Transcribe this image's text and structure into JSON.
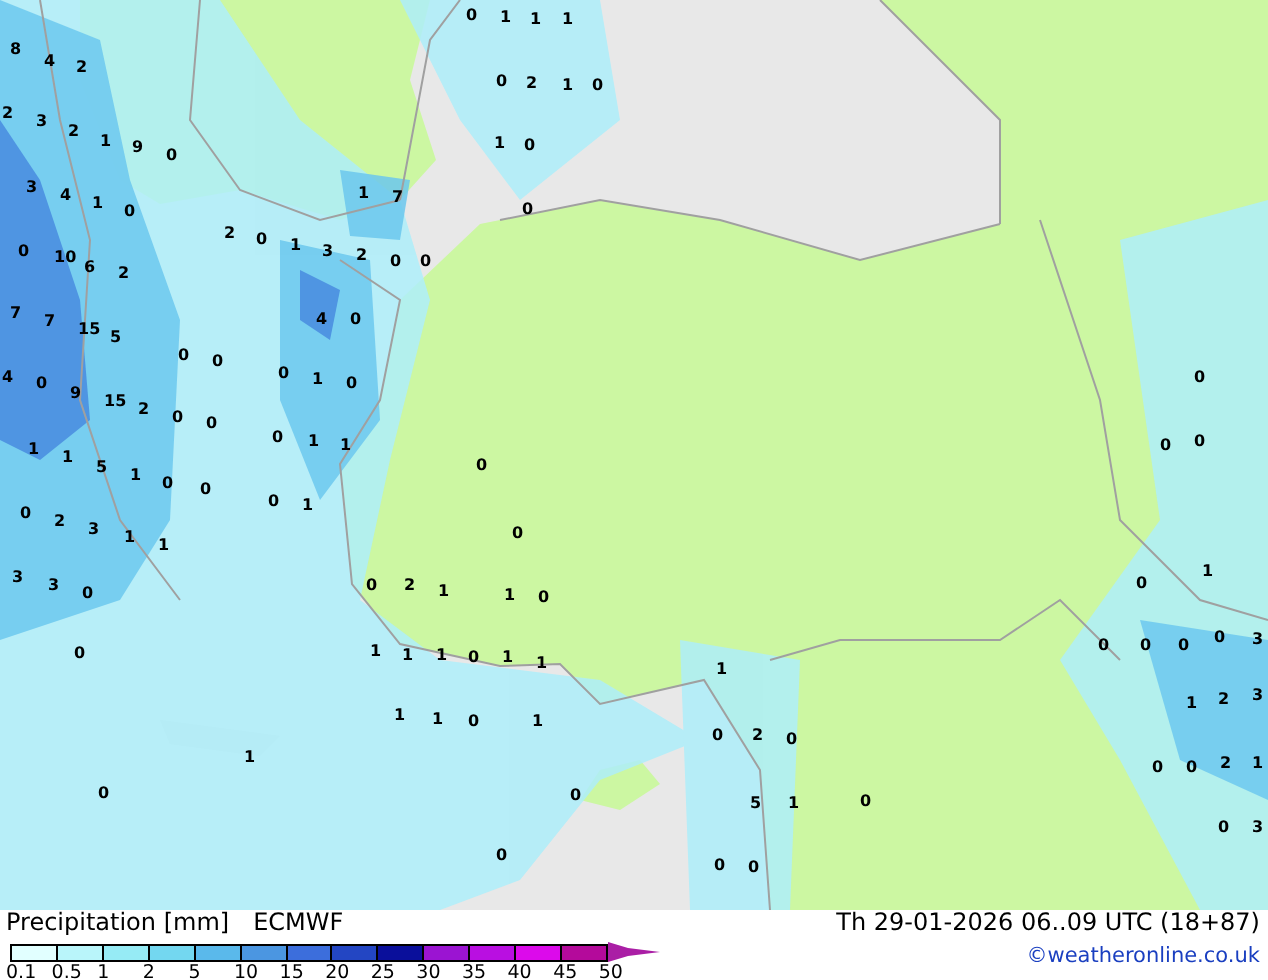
{
  "map": {
    "labels": [
      "0",
      "1",
      "1",
      "1",
      "8",
      "4",
      "2",
      "0",
      "2",
      "1",
      "0",
      "2",
      "3",
      "2",
      "1",
      "9",
      "0",
      "1",
      "0",
      "3",
      "4",
      "1",
      "0",
      "1",
      "7",
      "0",
      "0",
      "10",
      "6",
      "2",
      "2",
      "0",
      "1",
      "3",
      "2",
      "0",
      "0",
      "7",
      "7",
      "15",
      "5",
      "4",
      "0",
      "4",
      "0",
      "9",
      "15",
      "2",
      "0",
      "0",
      "0",
      "1",
      "0",
      "0",
      "1",
      "1",
      "5",
      "1",
      "0",
      "0",
      "0",
      "0",
      "0",
      "1",
      "1",
      "0",
      "0",
      "0",
      "0",
      "2",
      "3",
      "1",
      "1",
      "0",
      "1",
      "0",
      "3",
      "3",
      "0",
      "0",
      "2",
      "1",
      "1",
      "0",
      "0",
      "1",
      "0",
      "1",
      "1",
      "1",
      "0",
      "1",
      "1",
      "1",
      "0",
      "0",
      "0",
      "0",
      "3",
      "1",
      "1",
      "0",
      "1",
      "0",
      "2",
      "0",
      "1",
      "2",
      "3",
      "0",
      "1",
      "0",
      "5",
      "1",
      "0",
      "0",
      "0",
      "2",
      "1",
      "0",
      "0",
      "0",
      "0",
      "3"
    ]
  },
  "legend": {
    "title": "Precipitation [mm]",
    "model": "ECMWF",
    "bins": [
      {
        "color": "#e1ffff"
      },
      {
        "color": "#b9f5fa"
      },
      {
        "color": "#96ebf5"
      },
      {
        "color": "#73d7f0"
      },
      {
        "color": "#5ab9eb"
      },
      {
        "color": "#4b96e1"
      },
      {
        "color": "#3c6edc"
      },
      {
        "color": "#2346c3"
      },
      {
        "color": "#0a0f9b"
      },
      {
        "color": "#9b14d2"
      },
      {
        "color": "#b90fe1"
      },
      {
        "color": "#dc0aeb"
      },
      {
        "color": "#b40a9b"
      }
    ],
    "overflow": {
      "color": "#aa1ea5"
    },
    "ticks": [
      "0.1",
      "0.5",
      "1",
      "2",
      "5",
      "10",
      "15",
      "20",
      "25",
      "30",
      "35",
      "40",
      "45",
      "50"
    ],
    "valid_time": "Th 29-01-2026 06..09 UTC (18+87)",
    "credit": "©weatheronline.co.uk"
  }
}
